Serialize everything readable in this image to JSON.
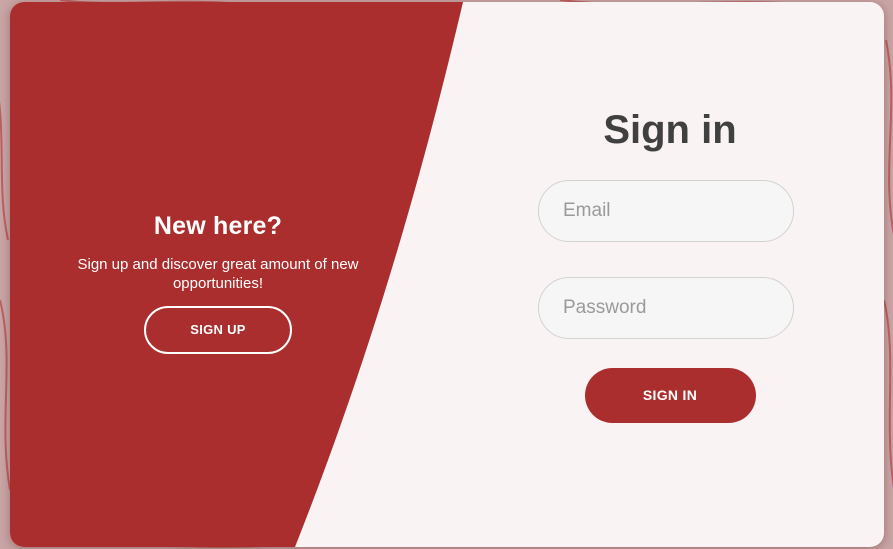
{
  "colors": {
    "primary": "#ab2e2e",
    "card_background": "#faf3f3",
    "title_text": "#404040",
    "page_background": "#c7a3a3"
  },
  "signup_panel": {
    "title": "New here?",
    "description": "Sign up and discover great amount of new opportunities!",
    "signup_button_label": "SIGN UP"
  },
  "signin_form": {
    "title": "Sign in",
    "email": {
      "placeholder": "Email",
      "value": ""
    },
    "password": {
      "placeholder": "Password",
      "value": ""
    },
    "signin_button_label": "SIGN IN"
  }
}
